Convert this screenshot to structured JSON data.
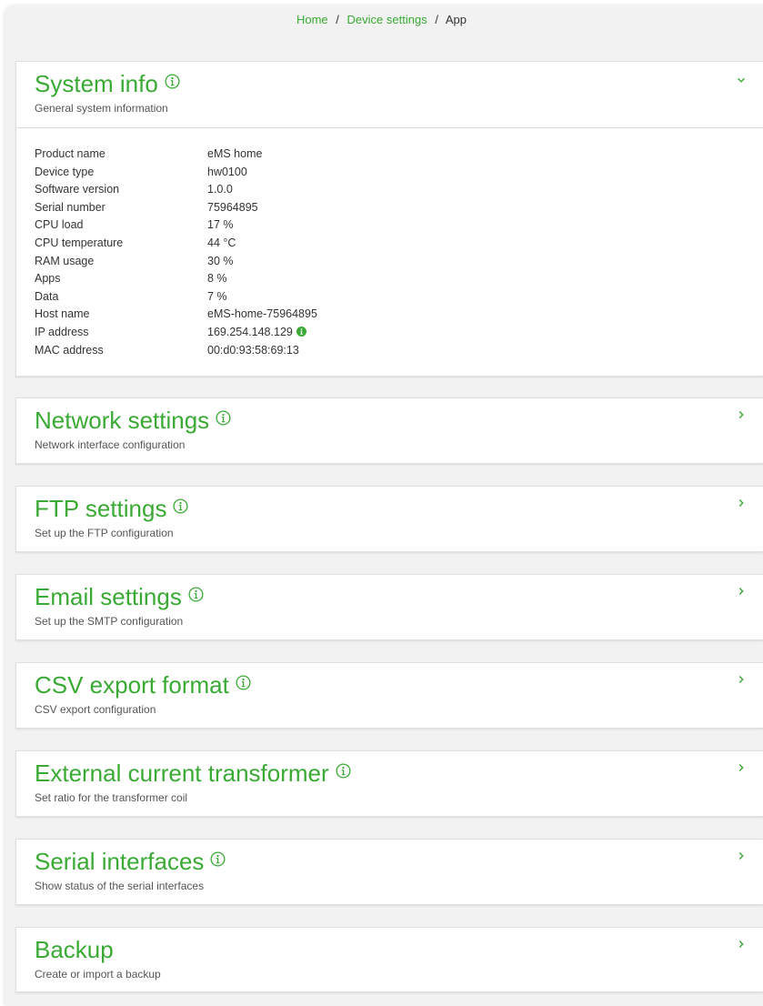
{
  "breadcrumb": {
    "home": "Home",
    "separator": "/",
    "device_settings": "Device settings",
    "current": "App"
  },
  "colors": {
    "accent": "#3aaa35",
    "background": "#f2f2f2",
    "card": "#ffffff"
  },
  "system_info": {
    "title": "System info",
    "subtitle": "General system information",
    "expanded": true,
    "icon": "chevron-down-icon",
    "rows": [
      {
        "label": "Product name",
        "value": "eMS home"
      },
      {
        "label": "Device type",
        "value": "hw0100"
      },
      {
        "label": "Software version",
        "value": "1.0.0"
      },
      {
        "label": "Serial number",
        "value": "75964895"
      },
      {
        "label": "CPU load",
        "value": "17 %"
      },
      {
        "label": "CPU temperature",
        "value": "44 °C"
      },
      {
        "label": "RAM usage",
        "value": "30 %"
      },
      {
        "label": "Apps",
        "value": "8 %"
      },
      {
        "label": "Data",
        "value": "7 %"
      },
      {
        "label": "Host name",
        "value": "eMS-home-75964895"
      },
      {
        "label": "IP address",
        "value": "169.254.148.129"
      },
      {
        "label": "MAC address",
        "value": "00:d0:93:58:69:13"
      }
    ]
  },
  "sections": [
    {
      "title": "Network settings",
      "subtitle": "Network interface configuration",
      "has_info": true
    },
    {
      "title": "FTP settings",
      "subtitle": "Set up the FTP configuration",
      "has_info": true
    },
    {
      "title": "Email settings",
      "subtitle": "Set up the SMTP configuration",
      "has_info": true
    },
    {
      "title": "CSV export format",
      "subtitle": "CSV export configuration",
      "has_info": true
    },
    {
      "title": "External current transformer",
      "subtitle": "Set ratio for the transformer coil",
      "has_info": true
    },
    {
      "title": "Serial interfaces",
      "subtitle": "Show status of the serial interfaces",
      "has_info": true
    },
    {
      "title": "Backup",
      "subtitle": "Create or import a backup",
      "has_info": false
    }
  ]
}
